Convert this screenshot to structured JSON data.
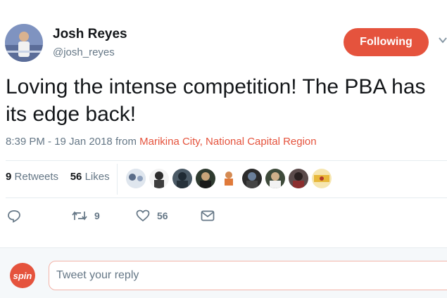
{
  "author": {
    "name": "Josh Reyes",
    "handle": "@josh_reyes"
  },
  "follow_button": {
    "label": "Following"
  },
  "tweet": {
    "text": "Loving the intense competition! The PBA has its edge back!",
    "timestamp": "8:39 PM - 19 Jan 2018",
    "from_label": "from",
    "location": "Marikina City, National Capital Region"
  },
  "stats": {
    "retweets_count": "9",
    "retweets_label": "Retweets",
    "likes_count": "56",
    "likes_label": "Likes"
  },
  "actions": {
    "reply_icon": "reply-icon",
    "retweet_count": "9",
    "like_count": "56",
    "message_icon": "envelope-icon"
  },
  "reply": {
    "avatar_text": "spin",
    "placeholder": "Tweet your reply"
  },
  "colors": {
    "accent": "#e5533d",
    "muted": "#657786",
    "text": "#14171a"
  }
}
